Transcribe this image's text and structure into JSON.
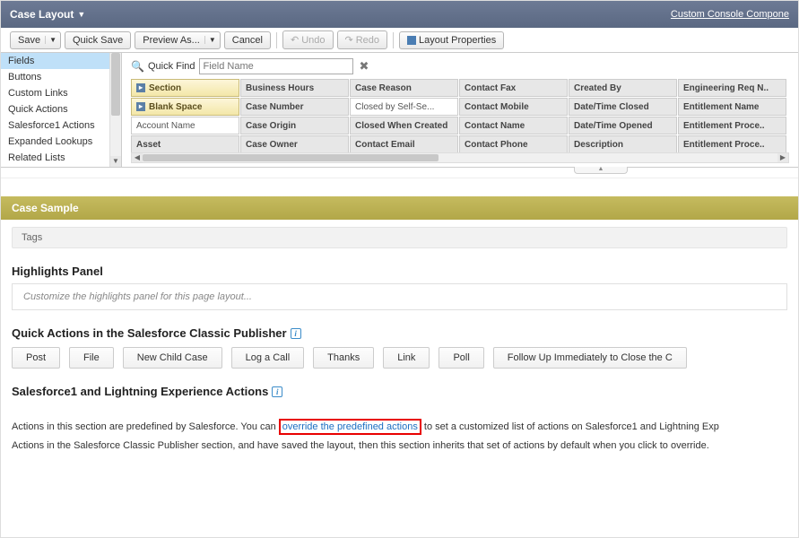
{
  "topbar": {
    "title": "Case Layout",
    "link": "Custom Console Compone"
  },
  "toolbar": {
    "save": "Save",
    "quickSave": "Quick Save",
    "preview": "Preview As...",
    "cancel": "Cancel",
    "undo": "Undo",
    "redo": "Redo",
    "layoutProps": "Layout Properties"
  },
  "paletteList": [
    "Fields",
    "Buttons",
    "Custom Links",
    "Quick Actions",
    "Salesforce1 Actions",
    "Expanded Lookups",
    "Related Lists"
  ],
  "quickFind": {
    "label": "Quick Find",
    "placeholder": "Field Name"
  },
  "fieldCols": [
    [
      {
        "t": "Section",
        "sp": true
      },
      {
        "t": "Blank Space",
        "sp": true
      },
      {
        "t": "Account Name"
      },
      {
        "t": "Asset",
        "f": true
      }
    ],
    [
      {
        "t": "Business Hours",
        "f": true
      },
      {
        "t": "Case Number",
        "f": true
      },
      {
        "t": "Case Origin",
        "f": true
      },
      {
        "t": "Case Owner",
        "f": true
      }
    ],
    [
      {
        "t": "Case Reason",
        "f": true
      },
      {
        "t": "Closed by Self-Se..."
      },
      {
        "t": "Closed When Created",
        "f": true
      },
      {
        "t": "Contact Email",
        "f": true
      }
    ],
    [
      {
        "t": "Contact Fax",
        "f": true
      },
      {
        "t": "Contact Mobile",
        "f": true
      },
      {
        "t": "Contact Name",
        "f": true
      },
      {
        "t": "Contact Phone",
        "f": true
      }
    ],
    [
      {
        "t": "Created By",
        "f": true
      },
      {
        "t": "Date/Time Closed",
        "f": true
      },
      {
        "t": "Date/Time Opened",
        "f": true
      },
      {
        "t": "Description",
        "f": true
      }
    ],
    [
      {
        "t": "Engineering Req N..",
        "f": true
      },
      {
        "t": "Entitlement Name",
        "f": true
      },
      {
        "t": "Entitlement Proce..",
        "f": true
      },
      {
        "t": "Entitlement Proce..",
        "f": true
      }
    ]
  ],
  "sampleHeader": "Case Sample",
  "tags": "Tags",
  "hp": {
    "title": "Highlights Panel",
    "placeholder": "Customize the highlights panel for this page layout..."
  },
  "qa": {
    "title": "Quick Actions in the Salesforce Classic Publisher",
    "items": [
      "Post",
      "File",
      "New Child Case",
      "Log a Call",
      "Thanks",
      "Link",
      "Poll",
      "Follow Up Immediately to Close the C"
    ]
  },
  "lx": {
    "title": "Salesforce1 and Lightning Experience Actions",
    "t1": "Actions in this section are predefined by Salesforce. You can ",
    "link": "override the predefined actions",
    "t2": " to set a customized list of actions on Salesforce1 and Lightning Exp",
    "t3": "Actions in the Salesforce Classic Publisher section, and have saved the layout, then this section inherits that set of actions by default when you click to override."
  }
}
